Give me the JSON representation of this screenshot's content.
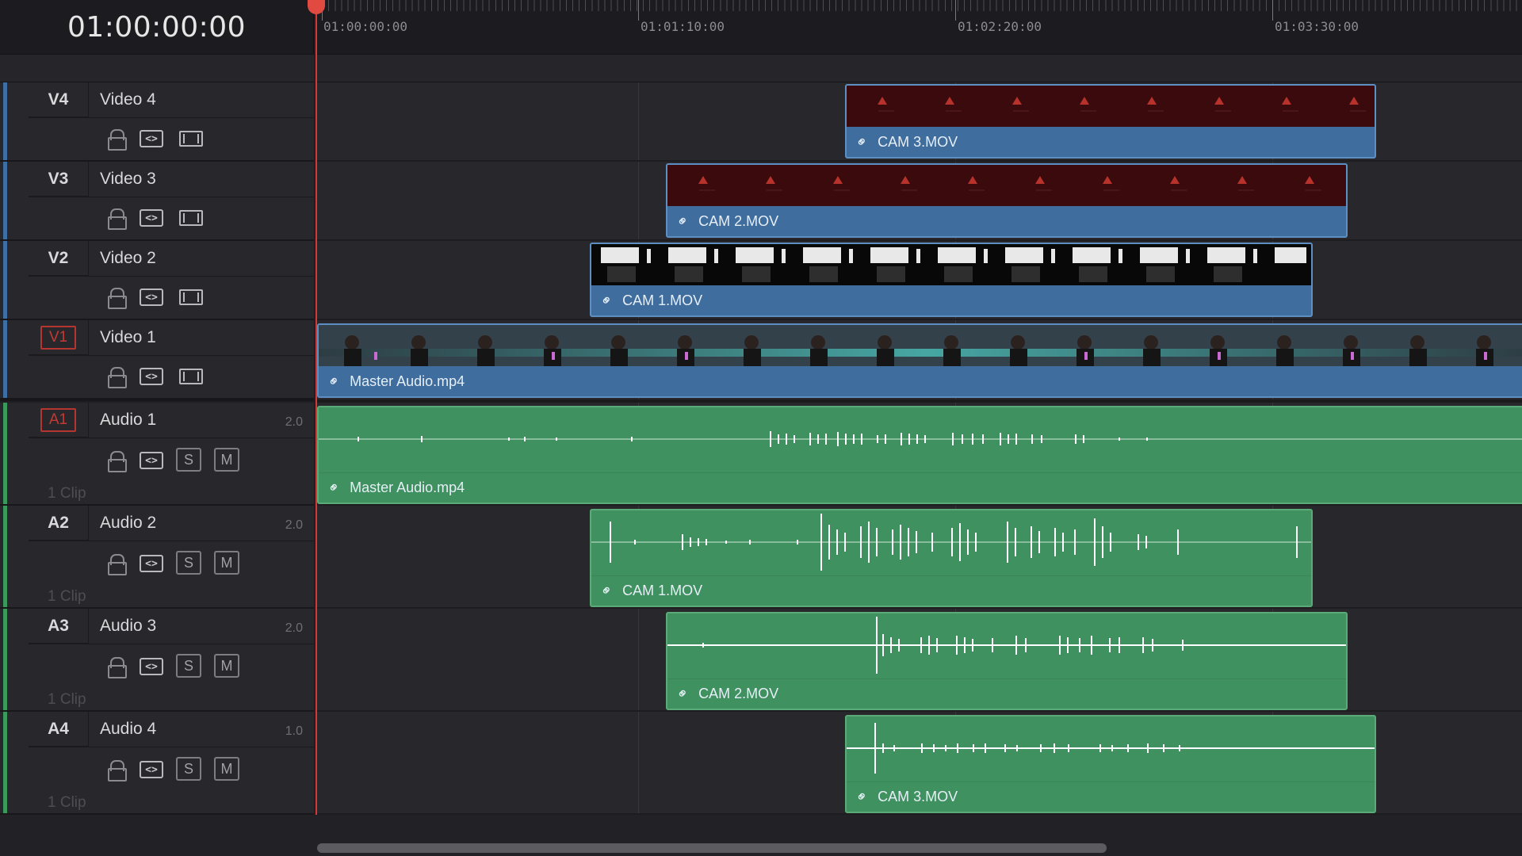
{
  "timecode": "01:00:00:00",
  "ruler_labels": [
    "01:00:00:00",
    "01:01:10:00",
    "01:02:20:00",
    "01:03:30:00"
  ],
  "video_tracks": [
    {
      "id": "V4",
      "name": "Video 4",
      "boxed": false
    },
    {
      "id": "V3",
      "name": "Video 3",
      "boxed": false
    },
    {
      "id": "V2",
      "name": "Video 2",
      "boxed": false
    },
    {
      "id": "V1",
      "name": "Video 1",
      "boxed": true
    }
  ],
  "audio_tracks": [
    {
      "id": "A1",
      "name": "Audio 1",
      "channels": "2.0",
      "clips": "1 Clip",
      "boxed": true
    },
    {
      "id": "A2",
      "name": "Audio 2",
      "channels": "2.0",
      "clips": "1 Clip",
      "boxed": false
    },
    {
      "id": "A3",
      "name": "Audio 3",
      "channels": "2.0",
      "clips": "1 Clip",
      "boxed": false
    },
    {
      "id": "A4",
      "name": "Audio 4",
      "channels": "1.0",
      "clips": "1 Clip",
      "boxed": false
    }
  ],
  "controls": {
    "solo": "S",
    "mute": "M",
    "autoselect": "<>"
  },
  "video_clips": {
    "v4": "CAM 3.MOV",
    "v3": "CAM 2.MOV",
    "v2": "CAM 1.MOV",
    "v1": "Master Audio.mp4"
  },
  "audio_clips": {
    "a1": "Master Audio.mp4",
    "a2": "CAM 1.MOV",
    "a3": "CAM 2.MOV",
    "a4": "CAM 3.MOV"
  },
  "colors": {
    "video_track": "#3d6fa6",
    "audio_track": "#3a9a5c",
    "playhead": "#d33a33",
    "video_clip": "#3f6d9d",
    "audio_clip": "#3f9160"
  },
  "icons": [
    "lock-icon",
    "auto-select-icon",
    "film-icon",
    "link-icon"
  ]
}
